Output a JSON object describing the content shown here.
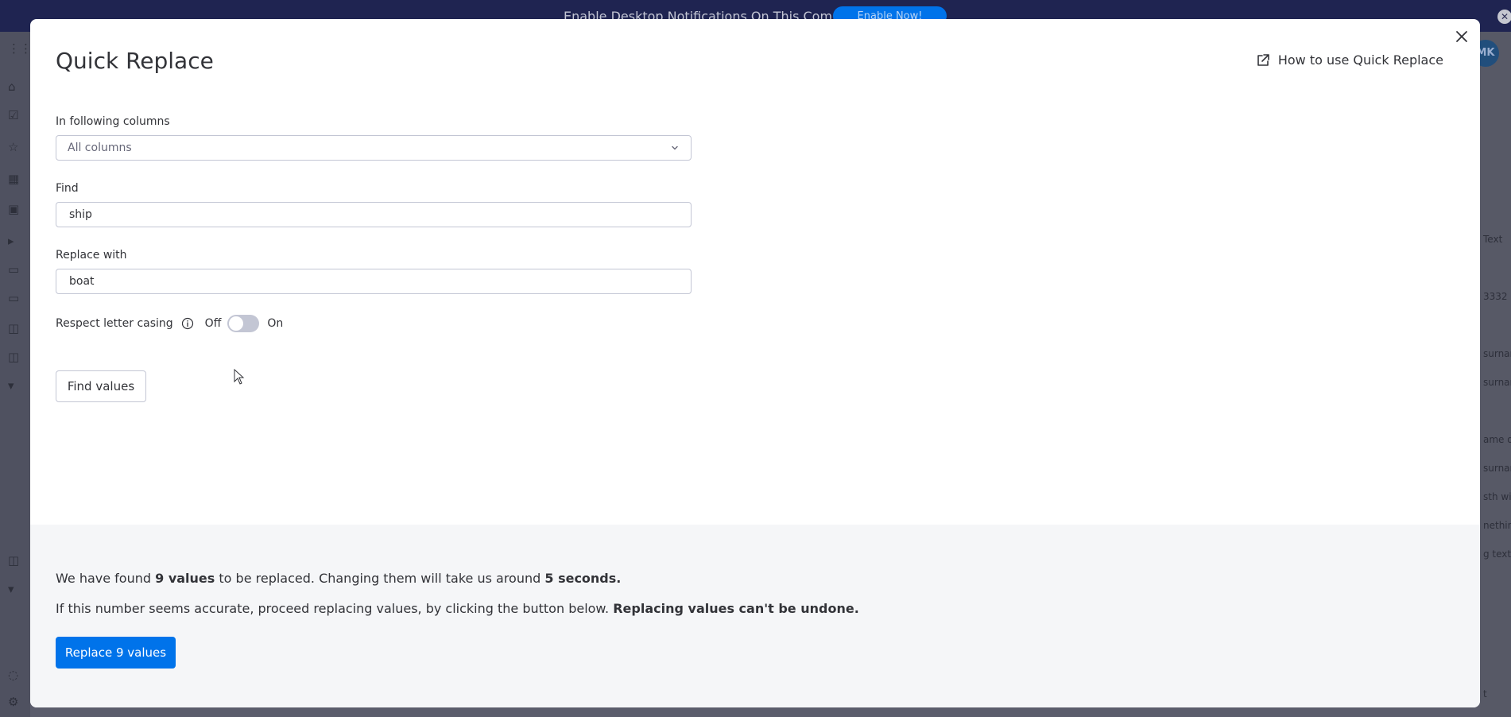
{
  "notification": {
    "text": "Enable Desktop Notifications On This Computer",
    "button_label": "Enable Now!"
  },
  "user": {
    "initials": "MK"
  },
  "background_right": {
    "texts": [
      "Text",
      "3332",
      "surnam",
      "surnam",
      "ame or",
      "surnam",
      "sth wit",
      "nethin",
      "g text v",
      "t"
    ]
  },
  "modal": {
    "title": "Quick Replace",
    "help_link": "How to use Quick Replace",
    "columns": {
      "label": "In following columns",
      "value": "All columns"
    },
    "find": {
      "label": "Find",
      "value": "ship"
    },
    "replace": {
      "label": "Replace with",
      "value": "boat"
    },
    "casing": {
      "label": "Respect letter casing",
      "off_label": "Off",
      "on_label": "On",
      "enabled": false
    },
    "find_button": "Find values",
    "results": {
      "line1_a": "We have found ",
      "count_text": "9 values",
      "line1_b": " to be replaced. Changing them will take us around ",
      "time_text": "5 seconds.",
      "line2_a": "If this number seems accurate, proceed replacing values, by clicking the button below. ",
      "line2_warning": "Replacing values can't be undone.",
      "replace_button": "Replace 9 values"
    }
  },
  "colors": {
    "primary": "#0073ea",
    "overlay": "#5b5d6c",
    "results_bg": "#f5f6f8"
  }
}
